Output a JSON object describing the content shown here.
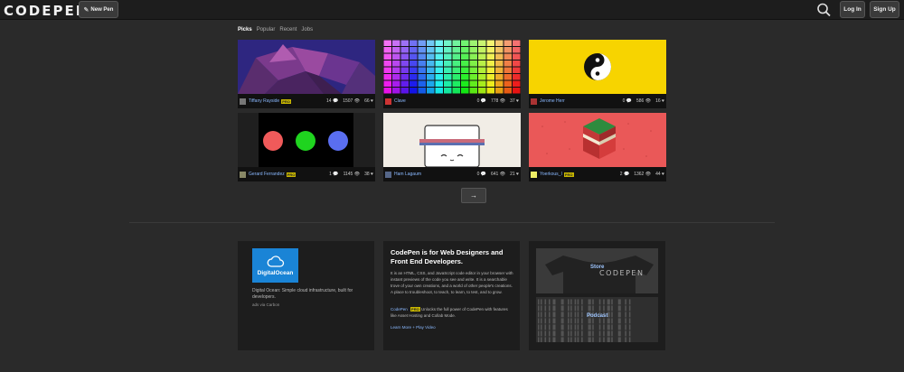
{
  "header": {
    "logo": "CODEPEN",
    "new_pen": "New Pen",
    "login": "Log In",
    "signup": "Sign Up"
  },
  "filters": [
    {
      "label": "Picks",
      "active": true
    },
    {
      "label": "Popular",
      "active": false
    },
    {
      "label": "Recent",
      "active": false
    },
    {
      "label": "Jobs",
      "active": false
    }
  ],
  "pens": [
    {
      "author": "Tiffany Rayside",
      "pro": "PRO",
      "comments": "14",
      "views": "1507",
      "hearts": "66",
      "thumb": "poly-art"
    },
    {
      "author": "Clave",
      "pro": "",
      "comments": "0",
      "views": "778",
      "hearts": "37",
      "thumb": "color-grid"
    },
    {
      "author": "Jerome Herr",
      "pro": "",
      "comments": "0",
      "views": "586",
      "hearts": "16",
      "thumb": "yin-yang"
    },
    {
      "author": "Gerard Ferrandez",
      "pro": "PRO",
      "comments": "1",
      "views": "1145",
      "hearts": "38",
      "thumb": "rgb-circles"
    },
    {
      "author": "Ham Lagaum",
      "pro": "",
      "comments": "0",
      "views": "641",
      "hearts": "21",
      "thumb": "cute-box"
    },
    {
      "author": "Yoerkous_I",
      "pro": "PRO",
      "comments": "2",
      "views": "1362",
      "hearts": "44",
      "thumb": "iso-block"
    }
  ],
  "next_arrow": "→",
  "ad": {
    "brand": "DigitalOcean",
    "text": "Digital Ocean: Simple cloud infrastructure, built for developers.",
    "via": "ads via Carbon"
  },
  "about": {
    "title": "CodePen is for Web Designers and Front End Developers.",
    "body": "It is an HTML, CSS, and JavaScript code editor in your browser with instant previews of the code you see and write. It is a searchable trove of your own creations, and a world of other people's creations. A place to troubleshoot, to teach, to learn, to test, and to grow.",
    "link": "CodePen",
    "pro": "PRO",
    "body2": "Unlocks the full power of CodePen with features like Asset Hosting and Collab Mode.",
    "learn": "Learn More + Play Video"
  },
  "promo": {
    "store": "Store",
    "podcast": "Podcast",
    "shirt_text": "CODEPEN"
  },
  "colors": {
    "accent": "#8ab9ff",
    "pro": "#c9b700",
    "do_blue": "#1a84d6"
  }
}
